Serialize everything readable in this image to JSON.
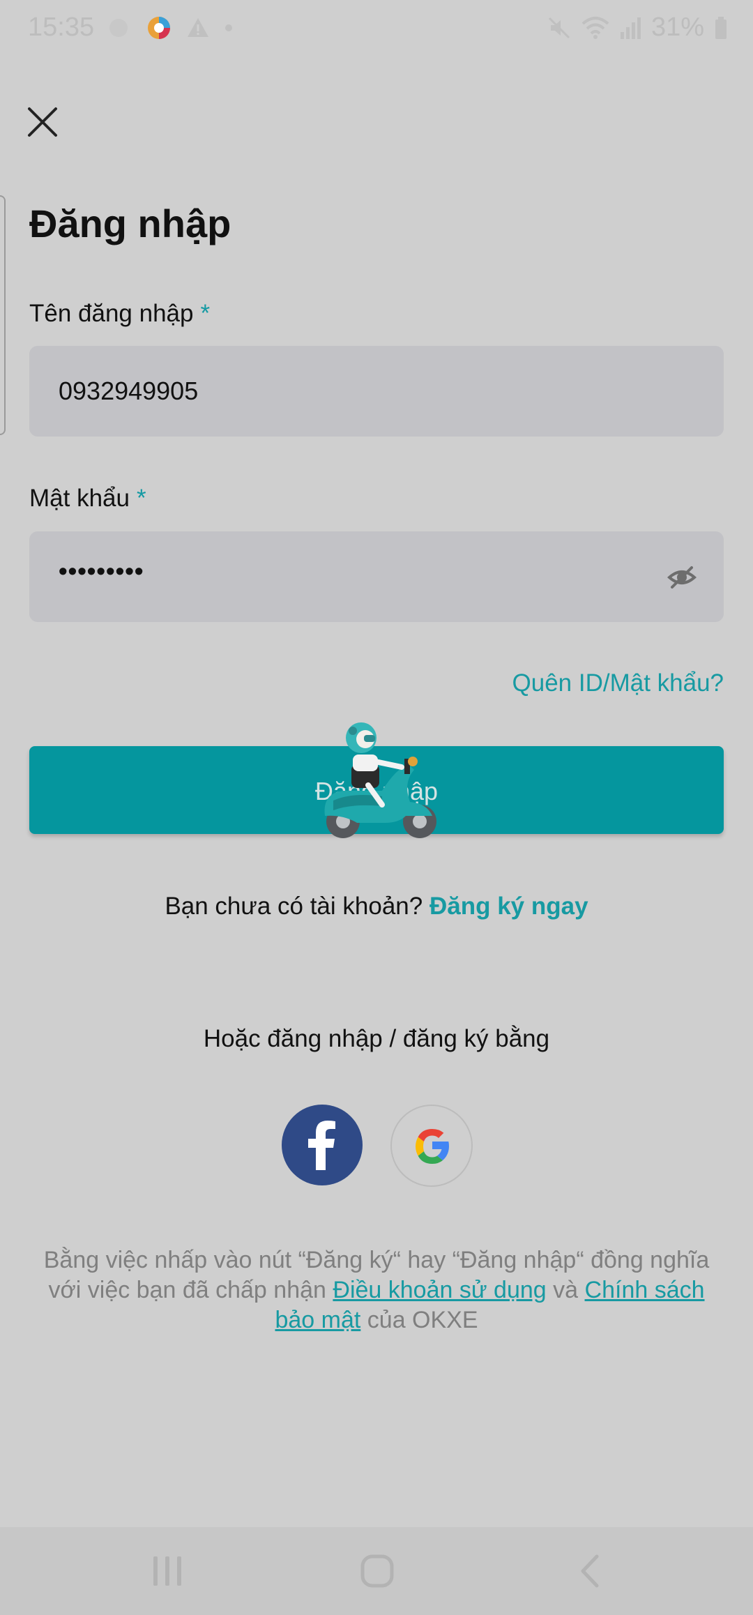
{
  "status_bar": {
    "time": "15:35",
    "battery_text": "31%",
    "icons": [
      "notification-app-icon",
      "warning-icon",
      "dot-icon",
      "mute-icon",
      "wifi-icon",
      "signal-icon",
      "battery-icon"
    ]
  },
  "page": {
    "title": "Đăng nhập"
  },
  "username": {
    "label": "Tên đăng nhập",
    "required_mark": "*",
    "value": "0932949905"
  },
  "password": {
    "label": "Mật khẩu",
    "required_mark": "*",
    "masked_value": "•••••••••"
  },
  "forgot": {
    "label": "Quên ID/Mật khẩu?"
  },
  "login_button": {
    "label": "Đăng nhập"
  },
  "signup": {
    "prompt": "Bạn chưa có tài khoản?",
    "link": "Đăng ký ngay"
  },
  "social": {
    "or_text": "Hoặc đăng nhập / đăng ký bằng",
    "providers": [
      "facebook",
      "google"
    ]
  },
  "terms": {
    "part1": "Bằng việc nhấp vào nút “Đăng ký“ hay “Đăng nhập“ đồng nghĩa với việc bạn đã chấp nhận",
    "link_terms": "Điều khoản sử dụng",
    "and": "và",
    "link_privacy": "Chính sách bảo mật",
    "part2": "của OKXE"
  },
  "colors": {
    "accent": "#05969e",
    "link": "#179aa2",
    "overlay_background": "#cfcfcf",
    "facebook": "#2f4a87"
  }
}
